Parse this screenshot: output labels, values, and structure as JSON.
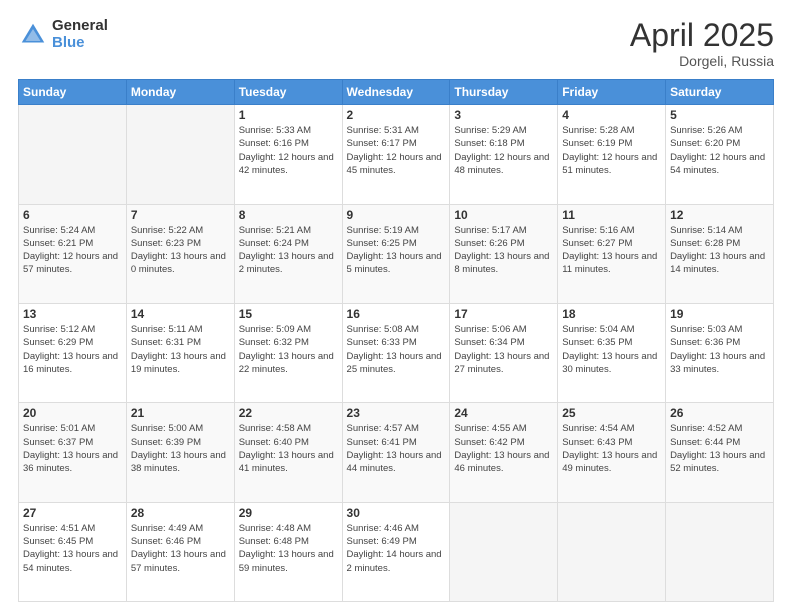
{
  "header": {
    "logo_general": "General",
    "logo_blue": "Blue",
    "month": "April 2025",
    "location": "Dorgeli, Russia"
  },
  "days_of_week": [
    "Sunday",
    "Monday",
    "Tuesday",
    "Wednesday",
    "Thursday",
    "Friday",
    "Saturday"
  ],
  "weeks": [
    [
      {
        "day": "",
        "info": ""
      },
      {
        "day": "",
        "info": ""
      },
      {
        "day": "1",
        "info": "Sunrise: 5:33 AM\nSunset: 6:16 PM\nDaylight: 12 hours and 42 minutes."
      },
      {
        "day": "2",
        "info": "Sunrise: 5:31 AM\nSunset: 6:17 PM\nDaylight: 12 hours and 45 minutes."
      },
      {
        "day": "3",
        "info": "Sunrise: 5:29 AM\nSunset: 6:18 PM\nDaylight: 12 hours and 48 minutes."
      },
      {
        "day": "4",
        "info": "Sunrise: 5:28 AM\nSunset: 6:19 PM\nDaylight: 12 hours and 51 minutes."
      },
      {
        "day": "5",
        "info": "Sunrise: 5:26 AM\nSunset: 6:20 PM\nDaylight: 12 hours and 54 minutes."
      }
    ],
    [
      {
        "day": "6",
        "info": "Sunrise: 5:24 AM\nSunset: 6:21 PM\nDaylight: 12 hours and 57 minutes."
      },
      {
        "day": "7",
        "info": "Sunrise: 5:22 AM\nSunset: 6:23 PM\nDaylight: 13 hours and 0 minutes."
      },
      {
        "day": "8",
        "info": "Sunrise: 5:21 AM\nSunset: 6:24 PM\nDaylight: 13 hours and 2 minutes."
      },
      {
        "day": "9",
        "info": "Sunrise: 5:19 AM\nSunset: 6:25 PM\nDaylight: 13 hours and 5 minutes."
      },
      {
        "day": "10",
        "info": "Sunrise: 5:17 AM\nSunset: 6:26 PM\nDaylight: 13 hours and 8 minutes."
      },
      {
        "day": "11",
        "info": "Sunrise: 5:16 AM\nSunset: 6:27 PM\nDaylight: 13 hours and 11 minutes."
      },
      {
        "day": "12",
        "info": "Sunrise: 5:14 AM\nSunset: 6:28 PM\nDaylight: 13 hours and 14 minutes."
      }
    ],
    [
      {
        "day": "13",
        "info": "Sunrise: 5:12 AM\nSunset: 6:29 PM\nDaylight: 13 hours and 16 minutes."
      },
      {
        "day": "14",
        "info": "Sunrise: 5:11 AM\nSunset: 6:31 PM\nDaylight: 13 hours and 19 minutes."
      },
      {
        "day": "15",
        "info": "Sunrise: 5:09 AM\nSunset: 6:32 PM\nDaylight: 13 hours and 22 minutes."
      },
      {
        "day": "16",
        "info": "Sunrise: 5:08 AM\nSunset: 6:33 PM\nDaylight: 13 hours and 25 minutes."
      },
      {
        "day": "17",
        "info": "Sunrise: 5:06 AM\nSunset: 6:34 PM\nDaylight: 13 hours and 27 minutes."
      },
      {
        "day": "18",
        "info": "Sunrise: 5:04 AM\nSunset: 6:35 PM\nDaylight: 13 hours and 30 minutes."
      },
      {
        "day": "19",
        "info": "Sunrise: 5:03 AM\nSunset: 6:36 PM\nDaylight: 13 hours and 33 minutes."
      }
    ],
    [
      {
        "day": "20",
        "info": "Sunrise: 5:01 AM\nSunset: 6:37 PM\nDaylight: 13 hours and 36 minutes."
      },
      {
        "day": "21",
        "info": "Sunrise: 5:00 AM\nSunset: 6:39 PM\nDaylight: 13 hours and 38 minutes."
      },
      {
        "day": "22",
        "info": "Sunrise: 4:58 AM\nSunset: 6:40 PM\nDaylight: 13 hours and 41 minutes."
      },
      {
        "day": "23",
        "info": "Sunrise: 4:57 AM\nSunset: 6:41 PM\nDaylight: 13 hours and 44 minutes."
      },
      {
        "day": "24",
        "info": "Sunrise: 4:55 AM\nSunset: 6:42 PM\nDaylight: 13 hours and 46 minutes."
      },
      {
        "day": "25",
        "info": "Sunrise: 4:54 AM\nSunset: 6:43 PM\nDaylight: 13 hours and 49 minutes."
      },
      {
        "day": "26",
        "info": "Sunrise: 4:52 AM\nSunset: 6:44 PM\nDaylight: 13 hours and 52 minutes."
      }
    ],
    [
      {
        "day": "27",
        "info": "Sunrise: 4:51 AM\nSunset: 6:45 PM\nDaylight: 13 hours and 54 minutes."
      },
      {
        "day": "28",
        "info": "Sunrise: 4:49 AM\nSunset: 6:46 PM\nDaylight: 13 hours and 57 minutes."
      },
      {
        "day": "29",
        "info": "Sunrise: 4:48 AM\nSunset: 6:48 PM\nDaylight: 13 hours and 59 minutes."
      },
      {
        "day": "30",
        "info": "Sunrise: 4:46 AM\nSunset: 6:49 PM\nDaylight: 14 hours and 2 minutes."
      },
      {
        "day": "",
        "info": ""
      },
      {
        "day": "",
        "info": ""
      },
      {
        "day": "",
        "info": ""
      }
    ]
  ]
}
